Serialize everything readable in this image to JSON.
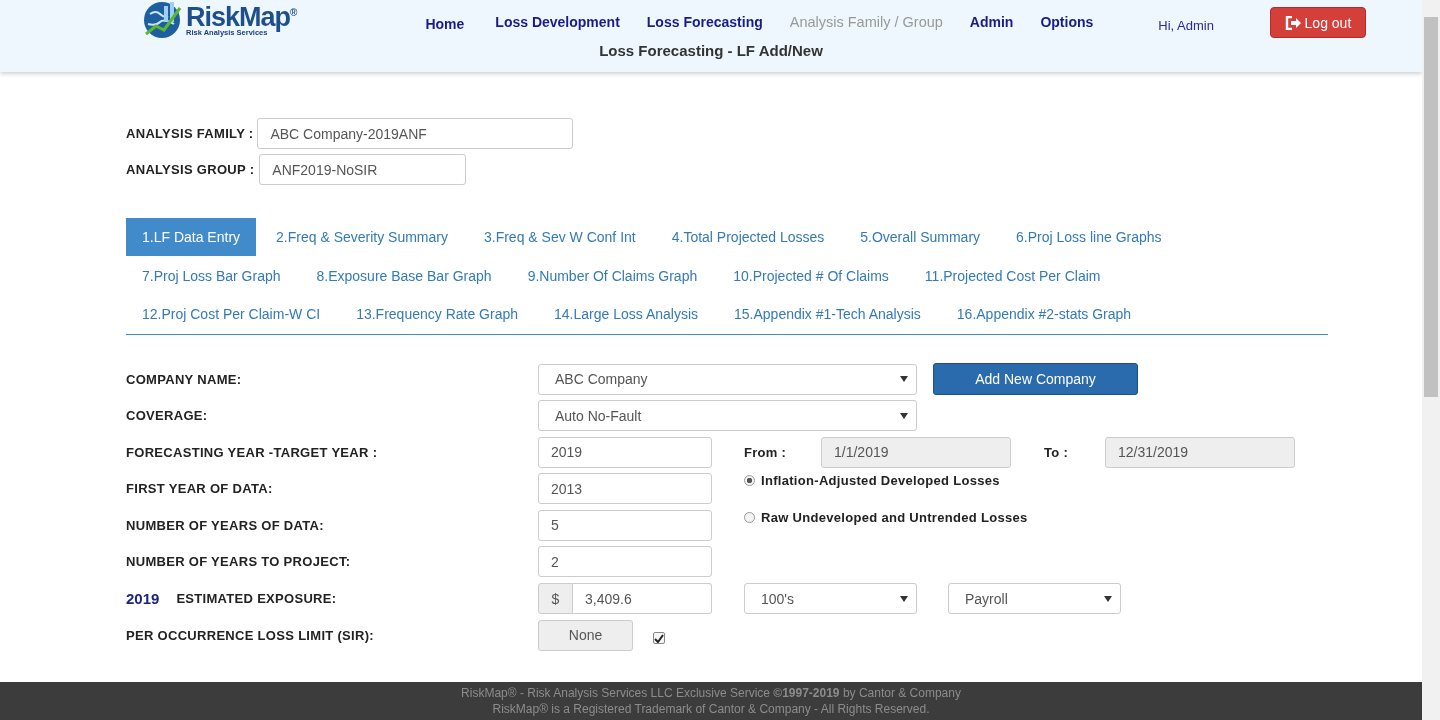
{
  "logo": {
    "name": "RiskMap",
    "mark": "®",
    "tagline": "Risk Analysis Services"
  },
  "nav": [
    {
      "label": "Home",
      "disabled": false
    },
    {
      "label": "Loss Development",
      "disabled": false
    },
    {
      "label": "Loss Forecasting",
      "disabled": false
    },
    {
      "label": "Analysis Family / Group",
      "disabled": true
    },
    {
      "label": "Admin",
      "disabled": false
    },
    {
      "label": "Options",
      "disabled": false
    }
  ],
  "greeting": "Hi, Admin",
  "logout_button": "Log out",
  "page_title": "Loss Forecasting - LF Add/New",
  "analysis_family": {
    "label": "ANALYSIS FAMILY :",
    "value": "ABC Company-2019ANF"
  },
  "analysis_group": {
    "label": "ANALYSIS GROUP :",
    "value": "ANF2019-NoSIR"
  },
  "tab_rows": [
    [
      {
        "label": "1.LF Data Entry",
        "selected": true
      },
      {
        "label": "2.Freq & Severity Summary",
        "selected": false
      },
      {
        "label": "3.Freq & Sev W Conf Int",
        "selected": false
      },
      {
        "label": "4.Total Projected Losses",
        "selected": false
      },
      {
        "label": "5.Overall Summary",
        "selected": false
      },
      {
        "label": "6.Proj Loss line Graphs",
        "selected": false
      }
    ],
    [
      {
        "label": "7.Proj Loss Bar Graph",
        "selected": false
      },
      {
        "label": "8.Exposure Base Bar Graph",
        "selected": false
      },
      {
        "label": "9.Number Of Claims Graph",
        "selected": false
      },
      {
        "label": "10.Projected # Of Claims",
        "selected": false
      },
      {
        "label": "11.Projected Cost Per Claim",
        "selected": false
      }
    ],
    [
      {
        "label": "12.Proj Cost Per Claim-W CI",
        "selected": false
      },
      {
        "label": "13.Frequency Rate Graph",
        "selected": false
      },
      {
        "label": "14.Large Loss Analysis",
        "selected": false
      },
      {
        "label": "15.Appendix #1-Tech Analysis",
        "selected": false
      },
      {
        "label": "16.Appendix #2-stats Graph",
        "selected": false
      }
    ]
  ],
  "form": [
    {
      "kind": "company",
      "label": "COMPANY NAME:",
      "value": "ABC Company",
      "button": "Add New Company"
    },
    {
      "kind": "select",
      "label": "COVERAGE:",
      "value": "Auto No-Fault"
    },
    {
      "kind": "period",
      "label": "FORECASTING YEAR -TARGET YEAR :",
      "value": "2019",
      "from_label": "From :",
      "from": "1/1/2019",
      "to_label": "To :",
      "to": "12/31/2019"
    },
    {
      "kind": "radio",
      "label": "FIRST YEAR OF DATA:",
      "value": "2013",
      "option": "Inflation-Adjusted Developed Losses",
      "selected": true
    },
    {
      "kind": "radio",
      "label": "NUMBER OF YEARS OF DATA:",
      "value": "5",
      "option": "Raw Undeveloped and Untrended Losses",
      "selected": false
    },
    {
      "kind": "text",
      "label": "NUMBER OF YEARS TO PROJECT:",
      "value": "2"
    },
    {
      "kind": "exposure",
      "year": "2019",
      "label": "ESTIMATED EXPOSURE:",
      "prefix": "$",
      "value": "3,409.6",
      "unit": "100's",
      "base": "Payroll"
    },
    {
      "kind": "limit",
      "label": "PER OCCURRENCE LOSS LIMIT (SIR):",
      "button": "None",
      "checked": true
    }
  ],
  "footer": [
    "RiskMap® - Risk Analysis Services LLC Exclusive Service **©1997-2019** by Cantor & Company",
    "RiskMap® is a Registered Trademark of Cantor & Company - All Rights Reserved."
  ]
}
